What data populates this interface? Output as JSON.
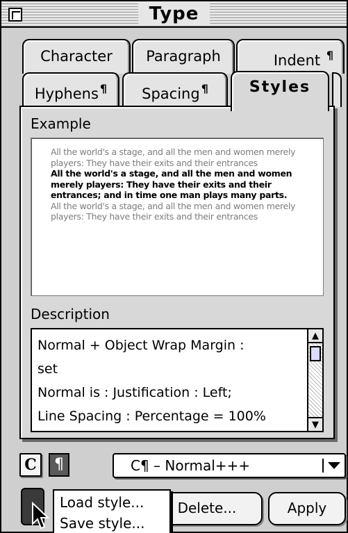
{
  "window": {
    "title": "Type"
  },
  "tabs": [
    {
      "label": "Character",
      "pilcrow": ""
    },
    {
      "label": "Paragraph",
      "pilcrow": ""
    },
    {
      "label": "Indent",
      "pilcrow": "¶"
    },
    {
      "label": "Hyphens",
      "pilcrow": "¶"
    },
    {
      "label": "Spacing",
      "pilcrow": "¶"
    },
    {
      "label": "Styles",
      "pilcrow": "",
      "active": true
    }
  ],
  "example": {
    "label": "Example",
    "paragraphs": [
      {
        "style": "preceding",
        "text": "All the world's a stage, and all the men and women merely players: They have their exits and their entrances"
      },
      {
        "style": "current",
        "text": "All the world's a stage, and all the men and women merely players: They have their exits and their entrances; and in time one man plays many parts."
      },
      {
        "style": "following",
        "text": "All the world's a stage, and all the men and women merely players: They have their exits and their entrances"
      }
    ]
  },
  "description": {
    "label": "Description",
    "text": "Normal + Object Wrap Margin :\nset\nNormal is : Justification : Left;\nLine Spacing : Percentage = 100%"
  },
  "toolbar": {
    "char_button": "C",
    "para_button": "¶",
    "style_selected": "C¶ – Normal+++"
  },
  "buttons": {
    "delete": "Delete...",
    "apply": "Apply"
  },
  "popup_menu": {
    "items": [
      "Load style...",
      "Save style..."
    ]
  },
  "colors": {
    "panel": "#d8d8d8",
    "example_light_text": "#7d7d7d",
    "pressed_button": "#3a3a3a"
  }
}
